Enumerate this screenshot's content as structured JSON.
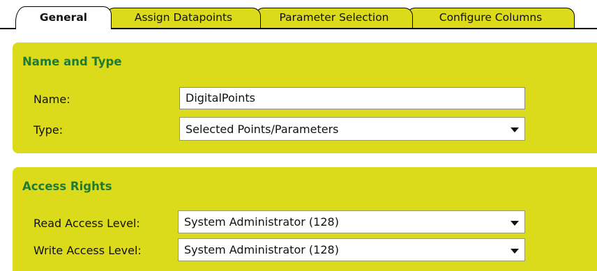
{
  "tabs": [
    {
      "label": "General",
      "active": true
    },
    {
      "label": "Assign Datapoints",
      "active": false
    },
    {
      "label": "Parameter Selection",
      "active": false
    },
    {
      "label": "Configure Columns",
      "active": false
    }
  ],
  "name_and_type": {
    "title": "Name and Type",
    "name_label": "Name:",
    "name_value": "DigitalPoints",
    "type_label": "Type:",
    "type_value": "Selected Points/Parameters"
  },
  "access_rights": {
    "title": "Access Rights",
    "read_label": "Read Access Level:",
    "read_value": "System Administrator (128)",
    "write_label": "Write Access Level:",
    "write_value": "System Administrator (128)"
  },
  "colors": {
    "panel_bg": "#dbdb1c",
    "section_title": "#1f7a33"
  }
}
